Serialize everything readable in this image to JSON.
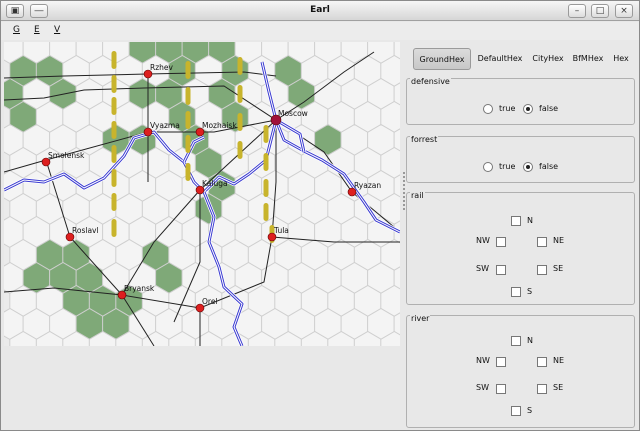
{
  "window": {
    "title": "Earl",
    "controls": [
      "minimize-icon",
      "maximize-icon",
      "close-icon"
    ]
  },
  "menu": {
    "items": [
      "G",
      "E",
      "V"
    ]
  },
  "map": {
    "colors": {
      "hex_fill": "#f4f4f4",
      "hex_border": "#cfcfcf",
      "forest": "#7fa978",
      "river": "#3a3ad0",
      "rail": "#c8b42c",
      "road": "#222222",
      "city": "#dd1f1f",
      "capital": "#a0103a"
    },
    "cities": [
      {
        "name": "Rzhev"
      },
      {
        "name": "Vyazma"
      },
      {
        "name": "Mozhaisk"
      },
      {
        "name": "Moscow"
      },
      {
        "name": "Smolensk"
      },
      {
        "name": "Kaluga"
      },
      {
        "name": "Ryazan"
      },
      {
        "name": "Roslavl"
      },
      {
        "name": "Tula"
      },
      {
        "name": "Bryansk"
      },
      {
        "name": "Orel"
      }
    ]
  },
  "tabs": [
    "GroundHex",
    "DefaultHex",
    "CityHex",
    "BfMHex",
    "Hex"
  ],
  "active_tab": "GroundHex",
  "defensive": {
    "title": "defensive",
    "true_label": "true",
    "false_label": "false",
    "value": false
  },
  "forrest": {
    "title": "forrest",
    "true_label": "true",
    "false_label": "false",
    "value": false
  },
  "rail": {
    "title": "rail",
    "n": "N",
    "nw": "NW",
    "ne": "NE",
    "sw": "SW",
    "se": "SE",
    "s": "S"
  },
  "river": {
    "title": "river",
    "n": "N",
    "nw": "NW",
    "ne": "NE",
    "sw": "SW",
    "se": "SE",
    "s": "S"
  }
}
